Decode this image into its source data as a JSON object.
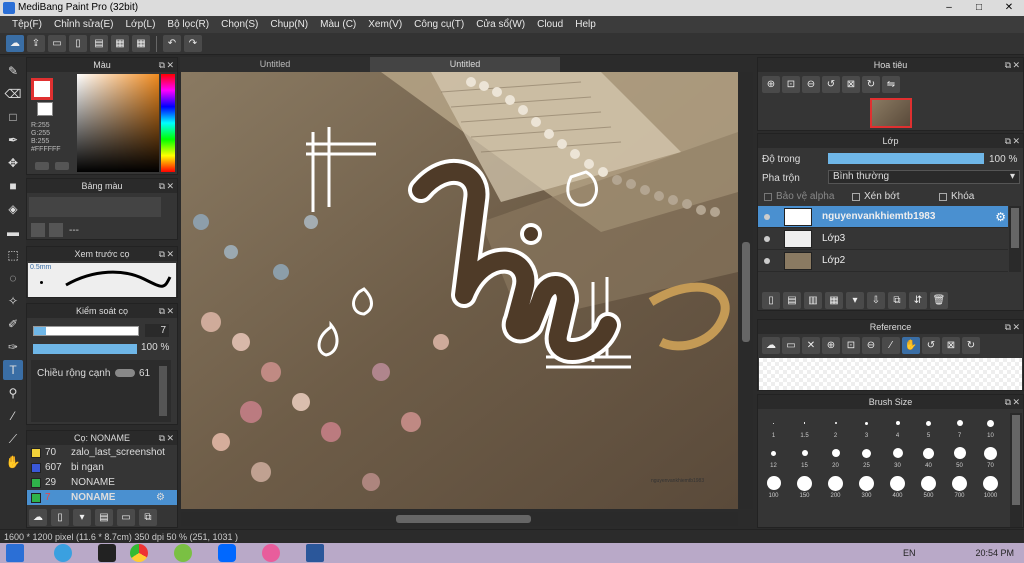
{
  "titlebar": {
    "title": "MediBang Paint Pro (32bit)"
  },
  "menu": [
    "Tệp(F)",
    "Chỉnh sửa(E)",
    "Lớp(L)",
    "Bộ lọc(R)",
    "Chọn(S)",
    "Chụp(N)",
    "Màu (C)",
    "Xem(V)",
    "Công cụ(T)",
    "Cửa sổ(W)",
    "Cloud",
    "Help"
  ],
  "tabs": [
    "Untitled",
    "Untitled"
  ],
  "color_panel": {
    "title": "Màu",
    "r": "R:255",
    "g": "G:255",
    "b": "B:255",
    "hex": "#FFFFFF"
  },
  "palette_panel": {
    "title": "Bảng màu",
    "value": "---"
  },
  "preview_panel": {
    "title": "Xem trước cọ",
    "size": "0.5mm"
  },
  "control_panel": {
    "title": "Kiểm soát cọ",
    "size_value": "7",
    "opacity_value": "100 %",
    "stabilizer_label": "Chiều rộng cạnh",
    "stabilizer_value": "61"
  },
  "brush_panel": {
    "title": "Cọ: NONAME",
    "items": [
      {
        "size": "70",
        "name": "zalo_last_screenshot",
        "color": "#f2d23a"
      },
      {
        "size": "607",
        "name": "bi ngan",
        "color": "#3a58d8"
      },
      {
        "size": "29",
        "name": "NONAME",
        "color": "#2fb34a"
      },
      {
        "size": "7",
        "name": "NONAME",
        "color": "#2fb34a"
      }
    ]
  },
  "navigator": {
    "title": "Hoa tiêu"
  },
  "layer_panel": {
    "title": "Lớp",
    "opacity_label": "Độ trong",
    "opacity_value": "100 %",
    "opacity_fraction": 1.0,
    "blend_label": "Pha trộn",
    "blend_value": "Bình thường",
    "protect_alpha": "Bảo vệ alpha",
    "clipping": "Xén bớt",
    "lock": "Khóa",
    "layers": [
      "nguyenvankhiemtb1983",
      "Lớp3",
      "Lớp2"
    ]
  },
  "reference_panel": {
    "title": "Reference"
  },
  "brush_size_panel": {
    "title": "Brush Size",
    "sizes": [
      "1",
      "1.5",
      "2",
      "3",
      "4",
      "5",
      "7",
      "10",
      "12",
      "15",
      "20",
      "25",
      "30",
      "40",
      "50",
      "70",
      "100",
      "150",
      "200",
      "300",
      "400",
      "500",
      "700",
      "1000"
    ]
  },
  "status": {
    "text": "1600 * 1200 pixel   (11.6 * 8.7cm)   350 dpi   50 %   (251, 1031 )"
  },
  "taskbar": {
    "lang": "EN",
    "time": "20:54 PM"
  },
  "canvas": {
    "text": "hi",
    "watermark": "nguyenvankhiemtb1983"
  },
  "colors": {
    "accent": "#4a90d0",
    "selection": "#6fb7e8"
  }
}
